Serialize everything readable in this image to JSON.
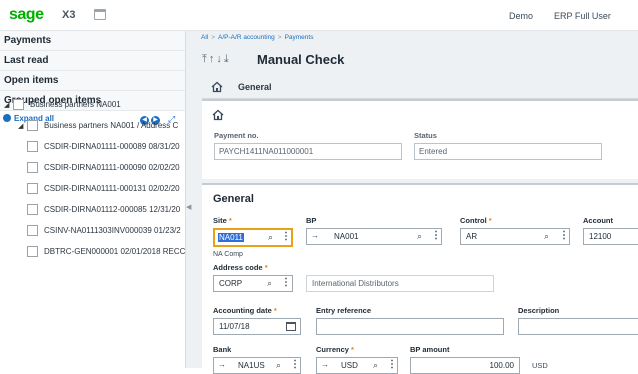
{
  "topbar": {
    "logo": "sage",
    "product": "X3",
    "links": [
      "Demo",
      "ERP Full User"
    ]
  },
  "left": {
    "headers": [
      "Payments",
      "Last read",
      "Open items",
      "Grouped open items"
    ],
    "expand_label": "Expand all",
    "tree": [
      {
        "label": "Business partners NA001",
        "level": 0
      },
      {
        "label": "Business partners NA001 / Address C",
        "level": 1
      },
      {
        "label": "CSDIR-DIRNA01111-000089 08/31/20",
        "level": 2
      },
      {
        "label": "CSDIR-DIRNA01111-000090 02/02/20",
        "level": 2
      },
      {
        "label": "CSDIR-DIRNA01111-000131 02/02/20",
        "level": 2
      },
      {
        "label": "CSDIR-DIRNA01112-000085 12/31/20",
        "level": 2
      },
      {
        "label": "CSINV-NA0111303INV000039 01/23/2",
        "level": 2
      },
      {
        "label": "DBTRC-GEN000001 02/01/2018 RECC",
        "level": 2
      }
    ]
  },
  "breadcrumb": [
    "All",
    "A/P-A/R accounting",
    "Payments"
  ],
  "page_title": "Manual Check",
  "tab_label": "General",
  "header_fields": {
    "payment_no_label": "Payment no.",
    "payment_no": "PAYCH1411NA011000001",
    "status_label": "Status",
    "status": "Entered"
  },
  "general": {
    "title": "General",
    "site_label": "Site",
    "site": "NA011",
    "site_desc": "NA Comp",
    "bp_label": "BP",
    "bp": "NA001",
    "control_label": "Control",
    "control": "AR",
    "account_label": "Account",
    "account": "12100",
    "address_code_label": "Address code",
    "address_code": "CORP",
    "address_desc": "International Distributors",
    "accounting_date_label": "Accounting date",
    "accounting_date": "11/07/18",
    "entry_reference_label": "Entry reference",
    "entry_reference": "",
    "description_label": "Description",
    "description": "",
    "bank_label": "Bank",
    "bank": "NA1US",
    "currency_label": "Currency",
    "currency": "USD",
    "bp_amount_label": "BP amount",
    "bp_amount": "100.00",
    "bp_amount_currency": "USD",
    "required_mark": "*"
  }
}
